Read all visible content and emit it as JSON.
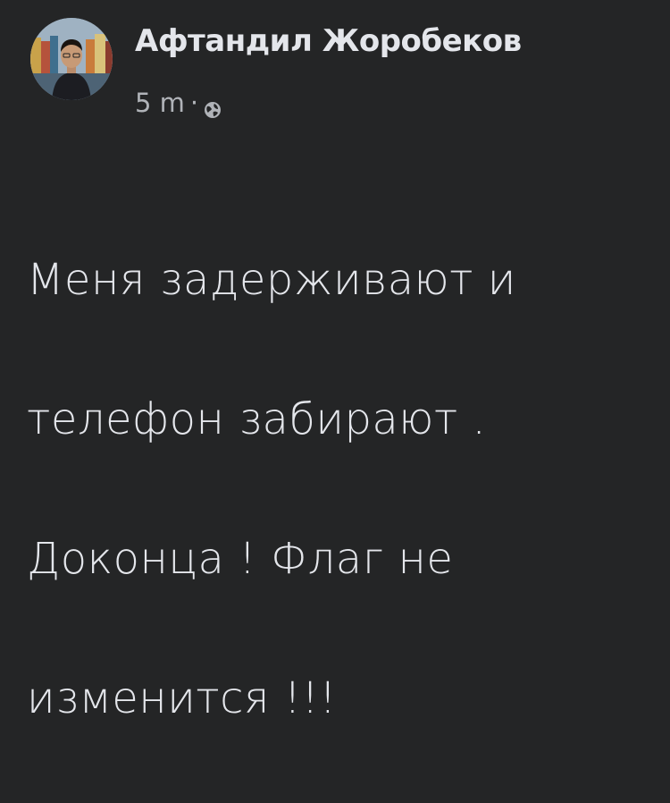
{
  "post": {
    "author": "Афтандил Жоробеков",
    "time": "5 m",
    "separator": "·",
    "privacy_icon": "globe-icon",
    "text_lines": [
      "Меня задерживают и",
      "телефон забирают .",
      "Доконца ! Флаг не",
      "изменится !!!"
    ]
  },
  "colors": {
    "background": "#242526",
    "primary_text": "#e4e6eb",
    "secondary_text": "#b0b3b8"
  }
}
